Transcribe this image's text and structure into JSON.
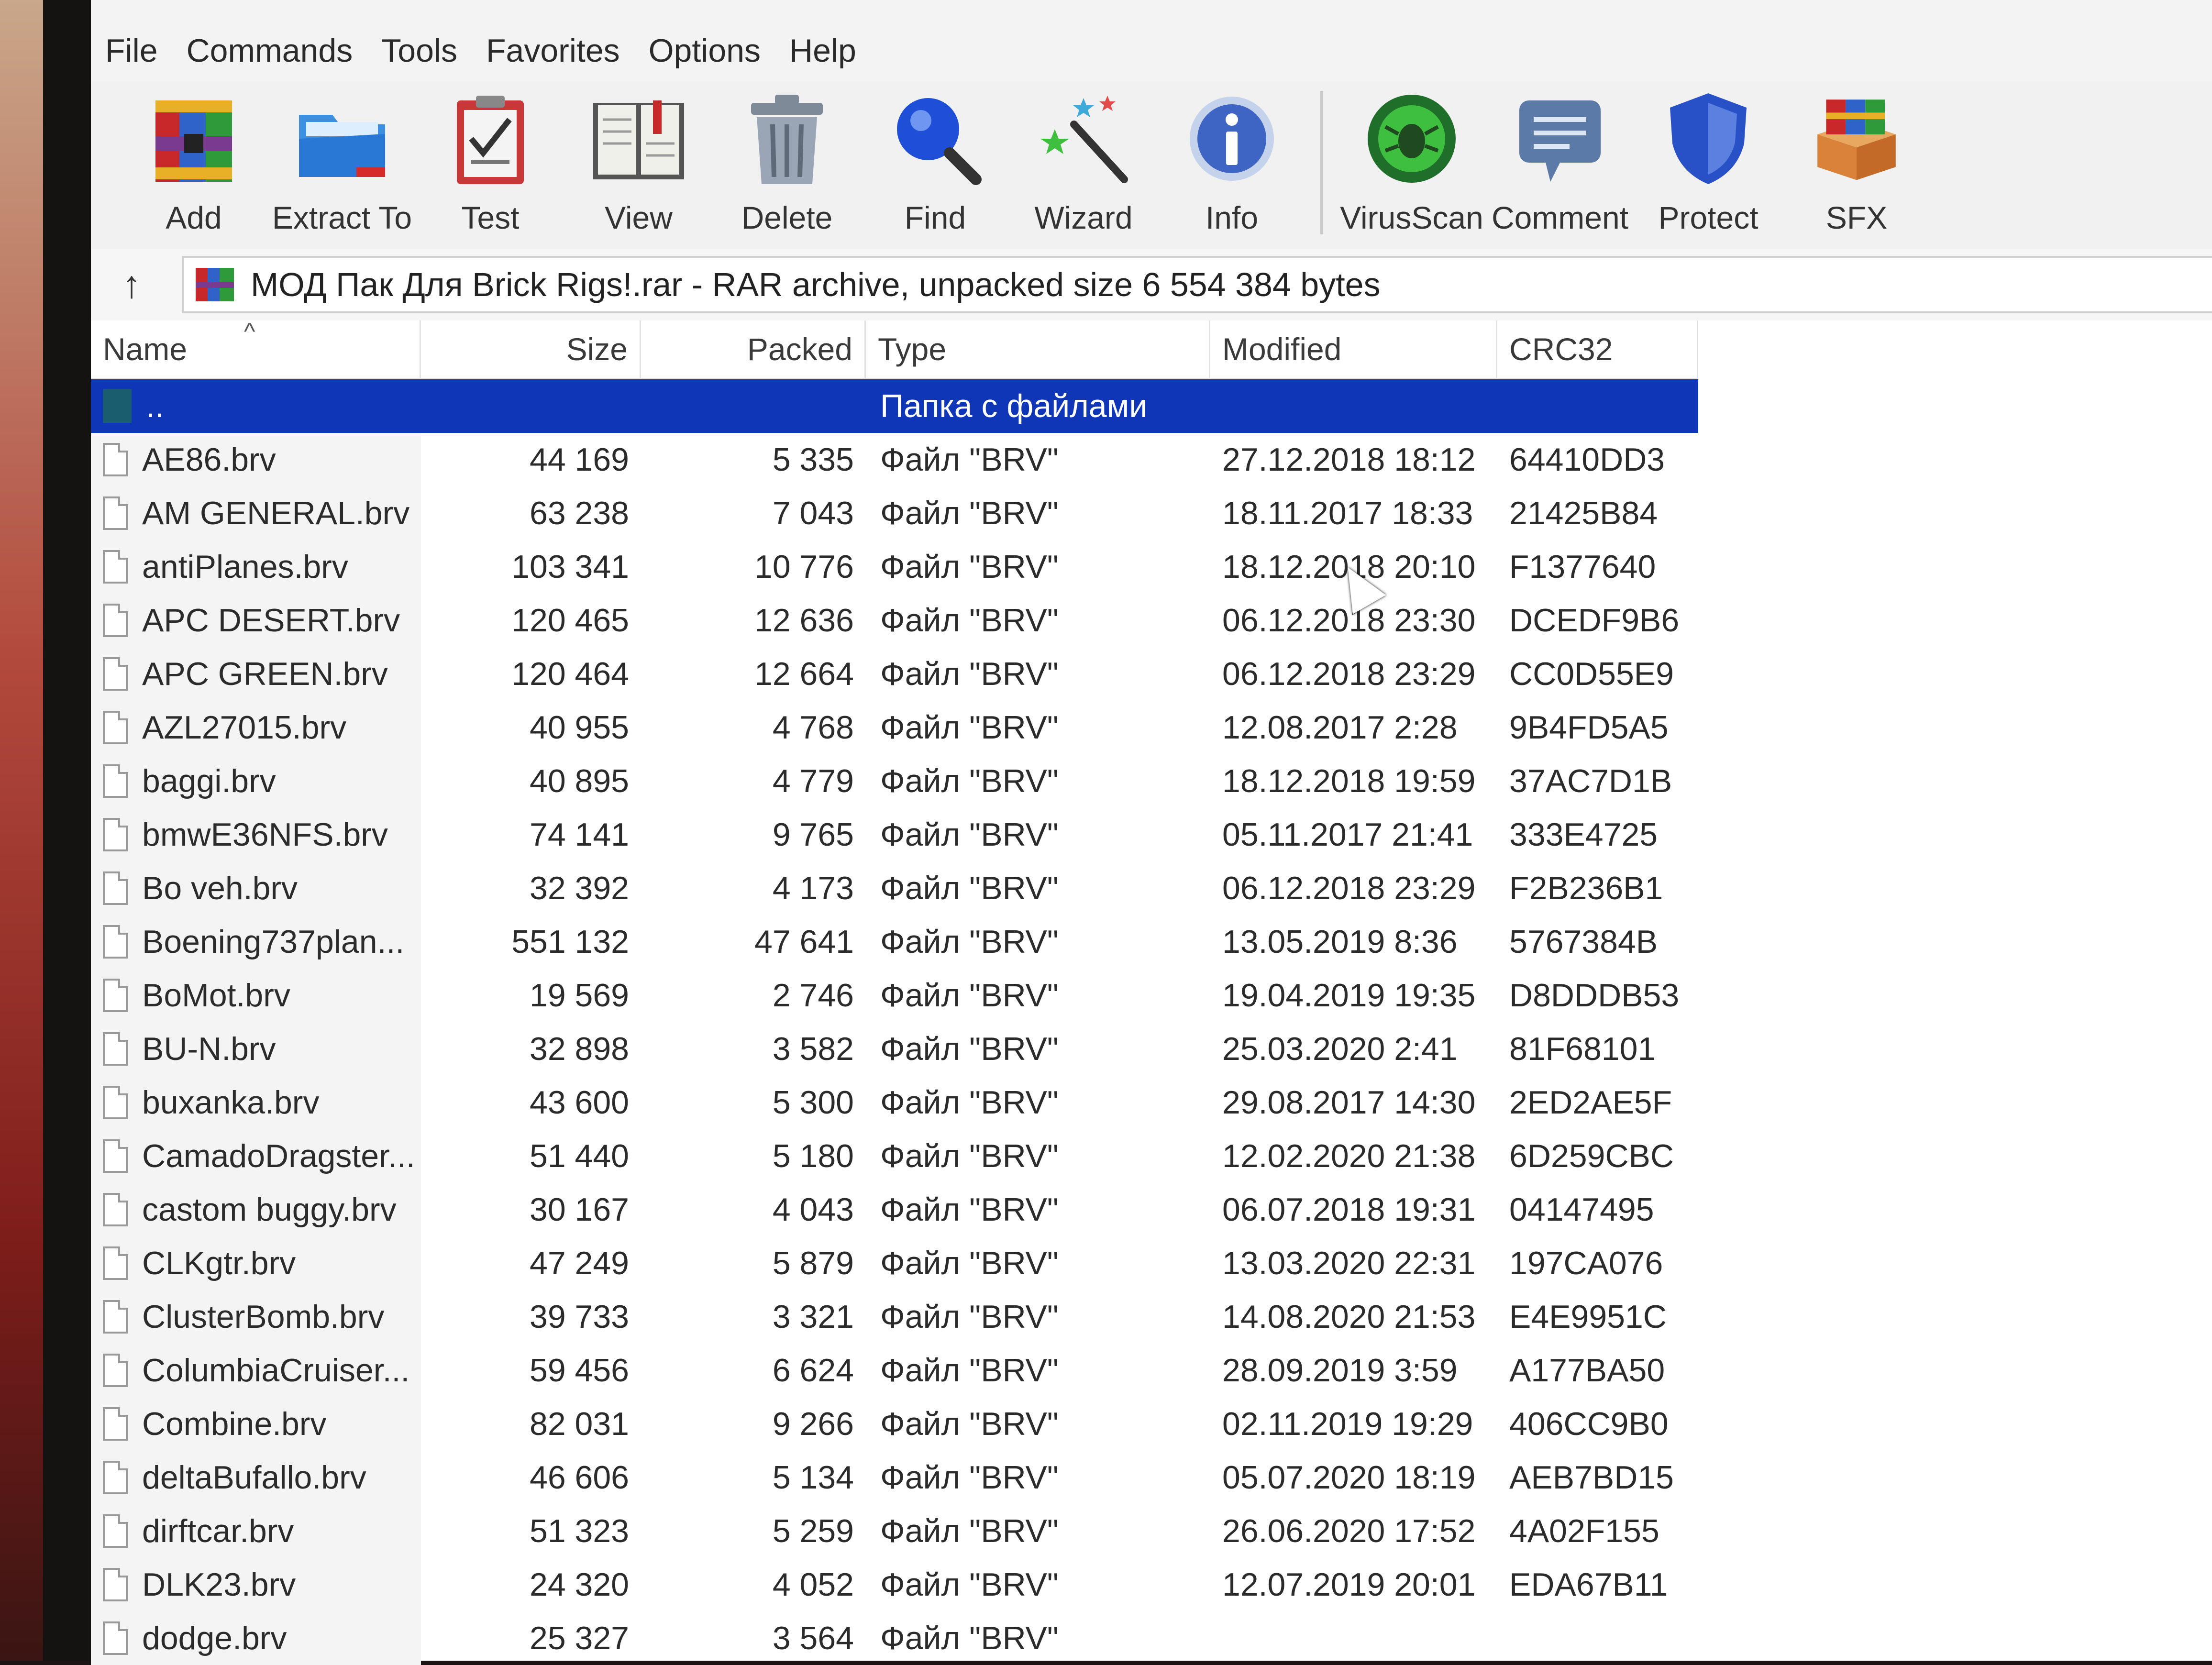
{
  "menu": [
    "File",
    "Commands",
    "Tools",
    "Favorites",
    "Options",
    "Help"
  ],
  "toolbar": [
    {
      "label": "Add",
      "icon": "add-archive-icon"
    },
    {
      "label": "Extract To",
      "icon": "extract-folder-icon"
    },
    {
      "label": "Test",
      "icon": "test-clipboard-icon"
    },
    {
      "label": "View",
      "icon": "view-book-icon"
    },
    {
      "label": "Delete",
      "icon": "trash-icon"
    },
    {
      "label": "Find",
      "icon": "magnifier-icon"
    },
    {
      "label": "Wizard",
      "icon": "wizard-wand-icon"
    },
    {
      "label": "Info",
      "icon": "info-icon"
    },
    {
      "label": "VirusScan",
      "icon": "virus-scan-icon"
    },
    {
      "label": "Comment",
      "icon": "comment-icon"
    },
    {
      "label": "Protect",
      "icon": "shield-icon"
    },
    {
      "label": "SFX",
      "icon": "sfx-box-icon"
    }
  ],
  "address": {
    "up_label": "↑",
    "path": "МОД Пак Для Brick Rigs!.rar - RAR archive, unpacked size 6 554 384 bytes"
  },
  "columns": {
    "name": "Name",
    "size": "Size",
    "packed": "Packed",
    "type": "Type",
    "modified": "Modified",
    "crc": "CRC32"
  },
  "parent_row": {
    "name": "..",
    "type": "Папка с файлами"
  },
  "files": [
    {
      "name": "AE86.brv",
      "size": "44 169",
      "packed": "5 335",
      "type": "Файл \"BRV\"",
      "modified": "27.12.2018 18:12",
      "crc": "64410DD3"
    },
    {
      "name": "AM GENERAL.brv",
      "size": "63 238",
      "packed": "7 043",
      "type": "Файл \"BRV\"",
      "modified": "18.11.2017 18:33",
      "crc": "21425B84"
    },
    {
      "name": "antiPlanes.brv",
      "size": "103 341",
      "packed": "10 776",
      "type": "Файл \"BRV\"",
      "modified": "18.12.2018 20:10",
      "crc": "F1377640"
    },
    {
      "name": "APC DESERT.brv",
      "size": "120 465",
      "packed": "12 636",
      "type": "Файл \"BRV\"",
      "modified": "06.12.2018 23:30",
      "crc": "DCEDF9B6"
    },
    {
      "name": "APC GREEN.brv",
      "size": "120 464",
      "packed": "12 664",
      "type": "Файл \"BRV\"",
      "modified": "06.12.2018 23:29",
      "crc": "CC0D55E9"
    },
    {
      "name": "AZL27015.brv",
      "size": "40 955",
      "packed": "4 768",
      "type": "Файл \"BRV\"",
      "modified": "12.08.2017 2:28",
      "crc": "9B4FD5A5"
    },
    {
      "name": "baggi.brv",
      "size": "40 895",
      "packed": "4 779",
      "type": "Файл \"BRV\"",
      "modified": "18.12.2018 19:59",
      "crc": "37AC7D1B"
    },
    {
      "name": "bmwE36NFS.brv",
      "size": "74 141",
      "packed": "9 765",
      "type": "Файл \"BRV\"",
      "modified": "05.11.2017 21:41",
      "crc": "333E4725"
    },
    {
      "name": "Bo veh.brv",
      "size": "32 392",
      "packed": "4 173",
      "type": "Файл \"BRV\"",
      "modified": "06.12.2018 23:29",
      "crc": "F2B236B1"
    },
    {
      "name": "Boening737plan...",
      "size": "551 132",
      "packed": "47 641",
      "type": "Файл \"BRV\"",
      "modified": "13.05.2019 8:36",
      "crc": "5767384B"
    },
    {
      "name": "BoMot.brv",
      "size": "19 569",
      "packed": "2 746",
      "type": "Файл \"BRV\"",
      "modified": "19.04.2019 19:35",
      "crc": "D8DDDB53"
    },
    {
      "name": "BU-N.brv",
      "size": "32 898",
      "packed": "3 582",
      "type": "Файл \"BRV\"",
      "modified": "25.03.2020 2:41",
      "crc": "81F68101"
    },
    {
      "name": "buxanka.brv",
      "size": "43 600",
      "packed": "5 300",
      "type": "Файл \"BRV\"",
      "modified": "29.08.2017 14:30",
      "crc": "2ED2AE5F"
    },
    {
      "name": "CamadoDragster...",
      "size": "51 440",
      "packed": "5 180",
      "type": "Файл \"BRV\"",
      "modified": "12.02.2020 21:38",
      "crc": "6D259CBC"
    },
    {
      "name": "castom buggy.brv",
      "size": "30 167",
      "packed": "4 043",
      "type": "Файл \"BRV\"",
      "modified": "06.07.2018 19:31",
      "crc": "04147495"
    },
    {
      "name": "CLKgtr.brv",
      "size": "47 249",
      "packed": "5 879",
      "type": "Файл \"BRV\"",
      "modified": "13.03.2020 22:31",
      "crc": "197CA076"
    },
    {
      "name": "ClusterBomb.brv",
      "size": "39 733",
      "packed": "3 321",
      "type": "Файл \"BRV\"",
      "modified": "14.08.2020 21:53",
      "crc": "E4E9951C"
    },
    {
      "name": "ColumbiaCruiser...",
      "size": "59 456",
      "packed": "6 624",
      "type": "Файл \"BRV\"",
      "modified": "28.09.2019 3:59",
      "crc": "A177BA50"
    },
    {
      "name": "Combine.brv",
      "size": "82 031",
      "packed": "9 266",
      "type": "Файл \"BRV\"",
      "modified": "02.11.2019 19:29",
      "crc": "406CC9B0"
    },
    {
      "name": "deltaBufallo.brv",
      "size": "46 606",
      "packed": "5 134",
      "type": "Файл \"BRV\"",
      "modified": "05.07.2020 18:19",
      "crc": "AEB7BD15"
    },
    {
      "name": "dirftcar.brv",
      "size": "51 323",
      "packed": "5 259",
      "type": "Файл \"BRV\"",
      "modified": "26.06.2020 17:52",
      "crc": "4A02F155"
    },
    {
      "name": "DLK23.brv",
      "size": "24 320",
      "packed": "4 052",
      "type": "Файл \"BRV\"",
      "modified": "12.07.2019 20:01",
      "crc": "EDA67B11"
    },
    {
      "name": "dodge.brv",
      "size": "25 327",
      "packed": "3 564",
      "type": "Файл \"BRV\"",
      "modified": "",
      "crc": ""
    }
  ]
}
